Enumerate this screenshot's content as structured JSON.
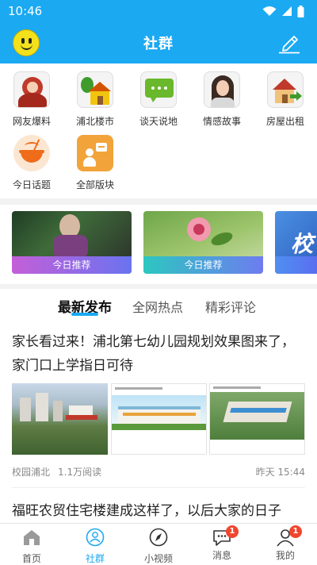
{
  "status_bar": {
    "time": "10:46",
    "icons": [
      "wifi-icon",
      "signal-icon",
      "battery-icon"
    ]
  },
  "header": {
    "title": "社群",
    "left_icon": "smiley-avatar-icon",
    "right_icon": "edit-pencil-icon"
  },
  "categories": [
    {
      "label": "网友爆料",
      "icon": "person-red-icon"
    },
    {
      "label": "浦北楼市",
      "icon": "house-tree-icon"
    },
    {
      "label": "谈天说地",
      "icon": "chat-bubble-icon"
    },
    {
      "label": "情感故事",
      "icon": "woman-portrait-icon"
    },
    {
      "label": "房屋出租",
      "icon": "house-arrow-icon"
    },
    {
      "label": "今日话题",
      "icon": "noodle-bowl-icon"
    },
    {
      "label": "全部版块",
      "icon": "person-board-icon"
    }
  ],
  "banners": [
    {
      "caption": "今日推荐"
    },
    {
      "caption": "今日推荐"
    },
    {
      "text": "校"
    }
  ],
  "tabs": [
    {
      "label": "最新发布",
      "active": true
    },
    {
      "label": "全网热点",
      "active": false
    },
    {
      "label": "精彩评论",
      "active": false
    }
  ],
  "articles": [
    {
      "title": "家长看过来！浦北第七幼儿园规划效果图来了，家门口上学指日可待",
      "source": "校园浦北",
      "reads": "1.1万阅读",
      "time": "昨天 15:44"
    },
    {
      "title": "福旺农贸住宅楼建成这样了，以后大家的日子"
    }
  ],
  "bottom_nav": [
    {
      "label": "首页",
      "icon": "home-icon",
      "active": false,
      "badge": null
    },
    {
      "label": "社群",
      "icon": "community-icon",
      "active": true,
      "badge": null
    },
    {
      "label": "小视频",
      "icon": "compass-icon",
      "active": false,
      "badge": null
    },
    {
      "label": "消息",
      "icon": "message-icon",
      "active": false,
      "badge": "1"
    },
    {
      "label": "我的",
      "icon": "profile-icon",
      "active": false,
      "badge": "1"
    }
  ],
  "colors": {
    "primary": "#1ba9f2",
    "badge": "#f2452e"
  }
}
